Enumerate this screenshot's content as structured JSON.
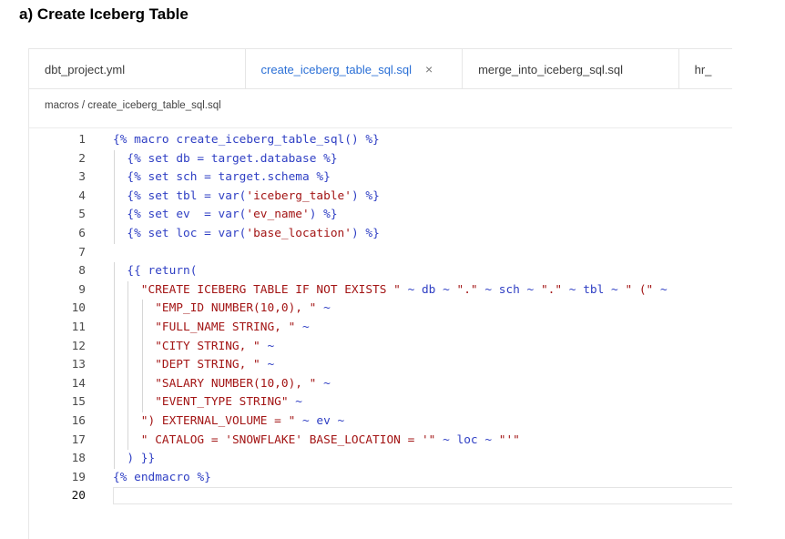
{
  "figure_title": "a) Create Iceberg Table",
  "tabs": [
    {
      "label": "dbt_project.yml",
      "active": false
    },
    {
      "label": "create_iceberg_table_sql.sql",
      "active": true,
      "close": "×"
    },
    {
      "label": "merge_into_iceberg_sql.sql",
      "active": false
    },
    {
      "label": "hr_",
      "active": false
    }
  ],
  "breadcrumb": "macros / create_iceberg_table_sql.sql",
  "colors": {
    "keyword": "#2f3fc4",
    "string": "#a31515",
    "active_tab": "#2a6fd6"
  },
  "code_lines": [
    {
      "n": "1",
      "indent": 0,
      "parts": [
        [
          "k",
          "{% macro create_iceberg_table_sql() %}"
        ]
      ]
    },
    {
      "n": "2",
      "indent": 1,
      "parts": [
        [
          "k",
          "{% set db = target.database %}"
        ]
      ]
    },
    {
      "n": "3",
      "indent": 1,
      "parts": [
        [
          "k",
          "{% set sch = target.schema %}"
        ]
      ]
    },
    {
      "n": "4",
      "indent": 1,
      "parts": [
        [
          "k",
          "{% set tbl = var("
        ],
        [
          "s",
          "'iceberg_table'"
        ],
        [
          "k",
          ") %}"
        ]
      ]
    },
    {
      "n": "5",
      "indent": 1,
      "parts": [
        [
          "k",
          "{% set ev  = var("
        ],
        [
          "s",
          "'ev_name'"
        ],
        [
          "k",
          ") %}"
        ]
      ]
    },
    {
      "n": "6",
      "indent": 1,
      "parts": [
        [
          "k",
          "{% set loc = var("
        ],
        [
          "s",
          "'base_location'"
        ],
        [
          "k",
          ") %}"
        ]
      ]
    },
    {
      "n": "7",
      "indent": 0,
      "parts": []
    },
    {
      "n": "8",
      "indent": 1,
      "parts": [
        [
          "k",
          "{{ return("
        ]
      ]
    },
    {
      "n": "9",
      "indent": 2,
      "parts": [
        [
          "s",
          "\"CREATE ICEBERG TABLE IF NOT EXISTS \""
        ],
        [
          "k",
          " ~ db ~ "
        ],
        [
          "s",
          "\".\""
        ],
        [
          "k",
          " ~ sch ~ "
        ],
        [
          "s",
          "\".\""
        ],
        [
          "k",
          " ~ tbl ~ "
        ],
        [
          "s",
          "\" (\""
        ],
        [
          "k",
          " ~"
        ]
      ]
    },
    {
      "n": "10",
      "indent": 3,
      "parts": [
        [
          "s",
          "\"EMP_ID NUMBER(10,0), \""
        ],
        [
          "k",
          " ~"
        ]
      ]
    },
    {
      "n": "11",
      "indent": 3,
      "parts": [
        [
          "s",
          "\"FULL_NAME STRING, \""
        ],
        [
          "k",
          " ~"
        ]
      ]
    },
    {
      "n": "12",
      "indent": 3,
      "parts": [
        [
          "s",
          "\"CITY STRING, \""
        ],
        [
          "k",
          " ~"
        ]
      ]
    },
    {
      "n": "13",
      "indent": 3,
      "parts": [
        [
          "s",
          "\"DEPT STRING, \""
        ],
        [
          "k",
          " ~"
        ]
      ]
    },
    {
      "n": "14",
      "indent": 3,
      "parts": [
        [
          "s",
          "\"SALARY NUMBER(10,0), \""
        ],
        [
          "k",
          " ~"
        ]
      ]
    },
    {
      "n": "15",
      "indent": 3,
      "parts": [
        [
          "s",
          "\"EVENT_TYPE STRING\""
        ],
        [
          "k",
          " ~"
        ]
      ]
    },
    {
      "n": "16",
      "indent": 2,
      "parts": [
        [
          "s",
          "\") EXTERNAL_VOLUME = \""
        ],
        [
          "k",
          " ~ ev ~"
        ]
      ]
    },
    {
      "n": "17",
      "indent": 2,
      "parts": [
        [
          "s",
          "\" CATALOG = 'SNOWFLAKE' BASE_LOCATION = '\""
        ],
        [
          "k",
          " ~ loc ~ "
        ],
        [
          "s",
          "\"'\""
        ]
      ]
    },
    {
      "n": "18",
      "indent": 1,
      "parts": [
        [
          "k",
          ") }}"
        ]
      ]
    },
    {
      "n": "19",
      "indent": 0,
      "parts": [
        [
          "k",
          "{% endmacro %}"
        ]
      ]
    },
    {
      "n": "20",
      "indent": 0,
      "parts": [],
      "current": true
    }
  ]
}
